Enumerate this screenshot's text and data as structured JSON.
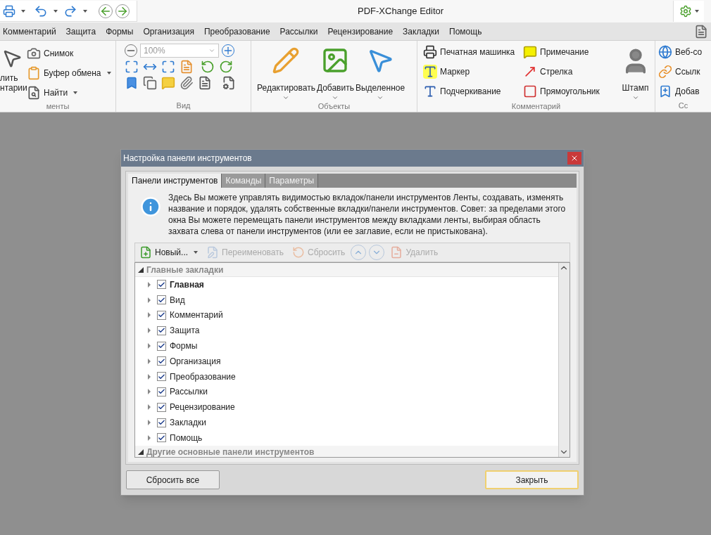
{
  "title_bar": {
    "title": "PDF-XChange Editor"
  },
  "menu": [
    "Комментарий",
    "Защита",
    "Формы",
    "Организация",
    "Преобразование",
    "Рассылки",
    "Рецензирование",
    "Закладки",
    "Помощь"
  ],
  "ribbon": {
    "groups": [
      {
        "kind": "tools",
        "label": "менты",
        "big": [
          "лить",
          "нтарии"
        ],
        "items": [
          {
            "label": "Снимок",
            "dropdown": false
          },
          {
            "label": "Буфер обмена",
            "dropdown": true
          },
          {
            "label": "Найти",
            "dropdown": true
          }
        ]
      },
      {
        "kind": "view",
        "label": "Вид",
        "zoom": "100%"
      },
      {
        "kind": "objects",
        "label": "Объекты",
        "items": [
          "Редактировать",
          "Добавить",
          "Выделенное"
        ]
      },
      {
        "kind": "comments",
        "label": "Комментарий",
        "items": [
          "Печатная машинка",
          "Примечание",
          "Маркер",
          "Стрелка",
          "Подчеркивание",
          "Прямоугольник"
        ],
        "stamp": "Штамп"
      },
      {
        "kind": "links",
        "label": "Сс",
        "items": [
          "Веб-со",
          "Ссылк",
          "Добав"
        ]
      }
    ]
  },
  "dialog": {
    "title": "Настройка панели инструментов",
    "tabs": [
      {
        "label": "Панели инструментов",
        "selected": true
      },
      {
        "label": "Команды",
        "selected": false
      },
      {
        "label": "Параметры",
        "selected": false
      }
    ],
    "info": "Здесь Вы можете управлять видимостью вкладок/панели инструментов Ленты, создавать,  изменять название и порядок, удалять собственные вкладки/панели инструментов. Совет: за пределами этого окна Вы можете перемещать панели инструментов между вкладками ленты, выбирая область захвата слева от панели инструментов (или ее заглавие, если не пристыкована).",
    "toolbar": [
      {
        "kind": "new",
        "label": "Новый...",
        "disabled": false
      },
      {
        "kind": "rename",
        "label": "Переименовать",
        "disabled": true
      },
      {
        "kind": "reset",
        "label": "Сбросить",
        "disabled": true
      },
      {
        "kind": "up",
        "disabled": true
      },
      {
        "kind": "down",
        "disabled": true
      },
      {
        "kind": "delete",
        "label": "Удалить",
        "disabled": true
      }
    ],
    "tree": [
      {
        "label": "Главные закладки",
        "expanded": true,
        "children": [
          {
            "label": "Главная",
            "checked": true,
            "bold": true,
            "expanded": false
          },
          {
            "label": "Вид",
            "checked": true,
            "bold": false,
            "expanded": false
          },
          {
            "label": "Комментарий",
            "checked": true,
            "bold": false,
            "expanded": false
          },
          {
            "label": "Защита",
            "checked": true,
            "bold": false,
            "expanded": false
          },
          {
            "label": "Формы",
            "checked": true,
            "bold": false,
            "expanded": false
          },
          {
            "label": "Организация",
            "checked": true,
            "bold": false,
            "expanded": false
          },
          {
            "label": "Преобразование",
            "checked": true,
            "bold": false,
            "expanded": false
          },
          {
            "label": "Рассылки",
            "checked": true,
            "bold": false,
            "expanded": false
          },
          {
            "label": "Рецензирование",
            "checked": true,
            "bold": false,
            "expanded": false
          },
          {
            "label": "Закладки",
            "checked": true,
            "bold": false,
            "expanded": false
          },
          {
            "label": "Помощь",
            "checked": true,
            "bold": false,
            "expanded": false
          }
        ]
      },
      {
        "label": "Другие основные панели инструментов",
        "expanded": true
      }
    ],
    "buttons": [
      {
        "label": "Сбросить все",
        "default": false
      },
      {
        "label": "Закрыть",
        "default": true
      }
    ]
  }
}
